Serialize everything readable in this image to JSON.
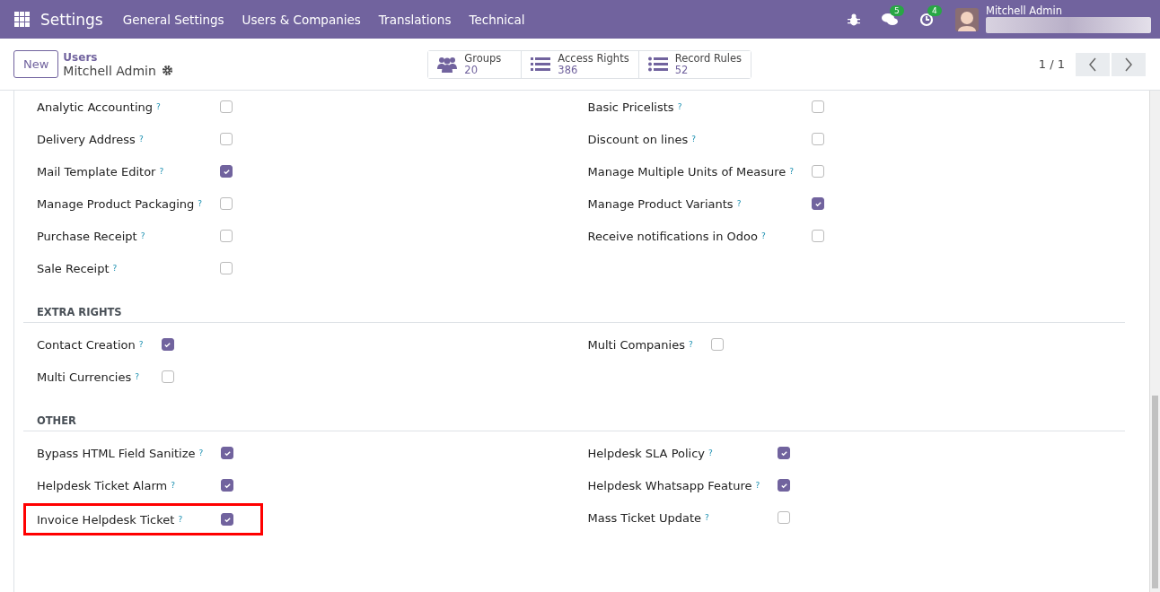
{
  "navbar": {
    "app": "Settings",
    "menus": [
      "General Settings",
      "Users & Companies",
      "Translations",
      "Technical"
    ],
    "messages_badge": "5",
    "activities_badge": "4",
    "user": "Mitchell Admin"
  },
  "control_panel": {
    "new_button": "New",
    "breadcrumb": "Users",
    "record": "Mitchell Admin",
    "smart_buttons": [
      {
        "label": "Groups",
        "count": "20",
        "kind": "groups"
      },
      {
        "label": "Access Rights",
        "count": "386",
        "kind": "list"
      },
      {
        "label": "Record Rules",
        "count": "52",
        "kind": "bullets"
      }
    ],
    "pager": "1 / 1"
  },
  "sections": [
    {
      "left": [
        {
          "label": "Analytic Accounting",
          "help": "?",
          "checked": false,
          "highlighted": false
        },
        {
          "label": "Delivery Address",
          "help": "?",
          "checked": false,
          "highlighted": false
        },
        {
          "label": "Mail Template Editor",
          "help": "?",
          "checked": true,
          "highlighted": false
        },
        {
          "label": "Manage Product Packaging",
          "help": "?",
          "checked": false,
          "highlighted": false
        },
        {
          "label": "Purchase Receipt",
          "help": "?",
          "checked": false,
          "highlighted": false
        },
        {
          "label": "Sale Receipt",
          "help": "?",
          "checked": false,
          "highlighted": false
        }
      ],
      "right": [
        {
          "label": "Basic Pricelists",
          "help": "?",
          "checked": false,
          "highlighted": false
        },
        {
          "label": "Discount on lines",
          "help": "?",
          "checked": false,
          "highlighted": false
        },
        {
          "label": "Manage Multiple Units of Measure",
          "help": "?",
          "checked": false,
          "highlighted": false
        },
        {
          "label": "Manage Product Variants",
          "help": "?",
          "checked": true,
          "highlighted": false
        },
        {
          "label": "Receive notifications in Odoo",
          "help": "?",
          "checked": false,
          "highlighted": false
        }
      ]
    },
    {
      "title": "EXTRA RIGHTS",
      "left": [
        {
          "label": "Contact Creation",
          "help": "?",
          "checked": true,
          "highlighted": false
        },
        {
          "label": "Multi Currencies",
          "help": "?",
          "checked": false,
          "highlighted": false
        }
      ],
      "right": [
        {
          "label": "Multi Companies",
          "help": "?",
          "checked": false,
          "highlighted": false
        }
      ]
    },
    {
      "title": "OTHER",
      "left": [
        {
          "label": "Bypass HTML Field Sanitize",
          "help": "?",
          "checked": true,
          "highlighted": false
        },
        {
          "label": "Helpdesk Ticket Alarm",
          "help": "?",
          "checked": true,
          "highlighted": false
        },
        {
          "label": "Invoice Helpdesk Ticket",
          "help": "?",
          "checked": true,
          "highlighted": true
        }
      ],
      "right": [
        {
          "label": "Helpdesk SLA Policy",
          "help": "?",
          "checked": true,
          "highlighted": false
        },
        {
          "label": "Helpdesk Whatsapp Feature",
          "help": "?",
          "checked": true,
          "highlighted": false
        },
        {
          "label": "Mass Ticket Update",
          "help": "?",
          "checked": false,
          "highlighted": false
        }
      ]
    }
  ]
}
